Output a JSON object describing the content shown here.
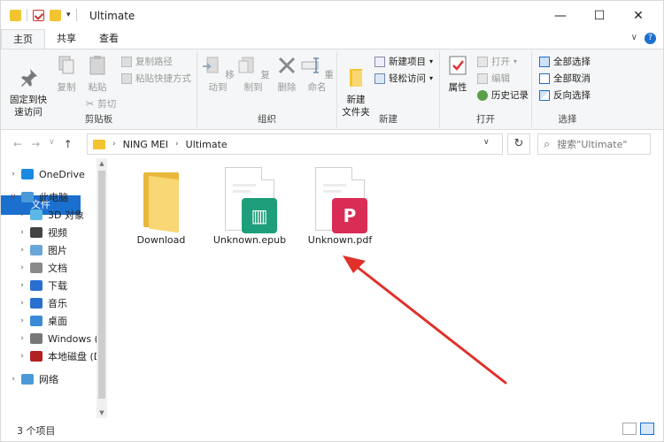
{
  "window": {
    "title": "Ultimate",
    "minimize_glyph": "—",
    "maximize_glyph": "☐",
    "close_glyph": "✕",
    "dropdown_glyph": "▾"
  },
  "tabs": [
    {
      "label": "文件"
    },
    {
      "label": "主页"
    },
    {
      "label": "共享"
    },
    {
      "label": "查看"
    }
  ],
  "tabs_right": {
    "collapse_glyph": "∨",
    "help_glyph": "?"
  },
  "ribbon": {
    "clipboard": {
      "pin": "固定到快\n速访问",
      "copy": "复制",
      "paste": "粘贴",
      "copy_path": "复制路径",
      "paste_shortcut": "粘贴快捷方式",
      "cut": "剪切",
      "label": "剪贴板"
    },
    "organize": {
      "move_to": "移动到",
      "copy_to": "复制到",
      "delete": "删除",
      "rename": "重命名",
      "label": "组织"
    },
    "new": {
      "new_folder": "新建\n文件夹",
      "new_item": "新建项目",
      "easy_access": "轻松访问",
      "label": "新建"
    },
    "open": {
      "properties": "属性",
      "open": "打开",
      "edit": "编辑",
      "history": "历史记录",
      "label": "打开"
    },
    "select": {
      "select_all": "全部选择",
      "select_none": "全部取消",
      "invert": "反向选择",
      "label": "选择"
    }
  },
  "address": {
    "segments": [
      "NING MEI",
      "Ultimate"
    ],
    "search_placeholder": "搜索\"Ultimate\"",
    "back_glyph": "←",
    "forward_glyph": "→",
    "history_glyph": "∨",
    "up_glyph": "↑",
    "refresh_glyph": "↻",
    "search_glyph": "⌕",
    "chevron": "›"
  },
  "navpane": {
    "items": [
      {
        "label": "OneDrive",
        "expander": "›",
        "icon_color": "#1a8ae0"
      },
      {
        "label": "此电脑",
        "expander": "∨",
        "icon_color": "#4a9ad8"
      },
      {
        "label": "3D 对象",
        "expander": "›",
        "icon_color": "#5bb8e6"
      },
      {
        "label": "视频",
        "expander": "›",
        "icon_color": "#444444"
      },
      {
        "label": "图片",
        "expander": "›",
        "icon_color": "#6aa7d8"
      },
      {
        "label": "文档",
        "expander": "›",
        "icon_color": "#8a8a8a"
      },
      {
        "label": "下载",
        "expander": "›",
        "icon_color": "#2a6fd0"
      },
      {
        "label": "音乐",
        "expander": "›",
        "icon_color": "#2a6fd0"
      },
      {
        "label": "桌面",
        "expander": "›",
        "icon_color": "#3a8ad8"
      },
      {
        "label": "Windows (C",
        "expander": "›",
        "icon_color": "#777777"
      },
      {
        "label": "本地磁盘 (D",
        "expander": "›",
        "icon_color": "#b22222"
      },
      {
        "label": "网络",
        "expander": "›",
        "icon_color": "#4a9ad8"
      }
    ]
  },
  "files": [
    {
      "name": "Download",
      "kind": "folder"
    },
    {
      "name": "Unknown.epub",
      "kind": "epub",
      "badge_color": "#1e9e7a",
      "badge_glyph": "▥"
    },
    {
      "name": "Unknown.pdf",
      "kind": "pdf",
      "badge_color": "#d92d56",
      "badge_glyph": "P"
    }
  ],
  "scrollbar": {
    "up_glyph": "▲",
    "down_glyph": "▼"
  },
  "status": {
    "count": "3 个项目"
  },
  "colors": {
    "accent": "#1a6fcf",
    "annotation_arrow": "#e0312a"
  }
}
